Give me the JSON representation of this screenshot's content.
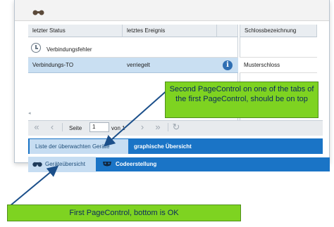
{
  "grid": {
    "columns": [
      "letzter Status",
      "letztes Ereignis",
      "",
      "Schlossbezeichnung"
    ],
    "group_label": "Verbindungsfehler",
    "rows": [
      {
        "status": "Verbindungs-TO",
        "event": "verriegelt",
        "lock": "Musterschloss"
      }
    ]
  },
  "pager": {
    "page_label": "Seite",
    "page_value": "1",
    "of_label": "von 1"
  },
  "inner_tabs": [
    {
      "label": "Liste der überwachten Geräte",
      "active": true
    },
    {
      "label": "graphische Übersicht",
      "active": false
    }
  ],
  "outer_tabs": [
    {
      "label": "Geräteübersicht",
      "active": true,
      "icon": "binoculars-icon"
    },
    {
      "label": "Codeerstellung",
      "active": false,
      "icon": "mask-icon"
    }
  ],
  "annotations": {
    "top": "Second PageControl on one of the tabs of the first PageControl, should be on top",
    "bottom": "First PageControl, bottom is OK"
  },
  "colors": {
    "tab_blue": "#1a74c6",
    "tab_active": "#c6ddf2",
    "row_selected": "#c9dff2",
    "callout_green": "#7ed321",
    "callout_text": "#0a2a5c"
  }
}
